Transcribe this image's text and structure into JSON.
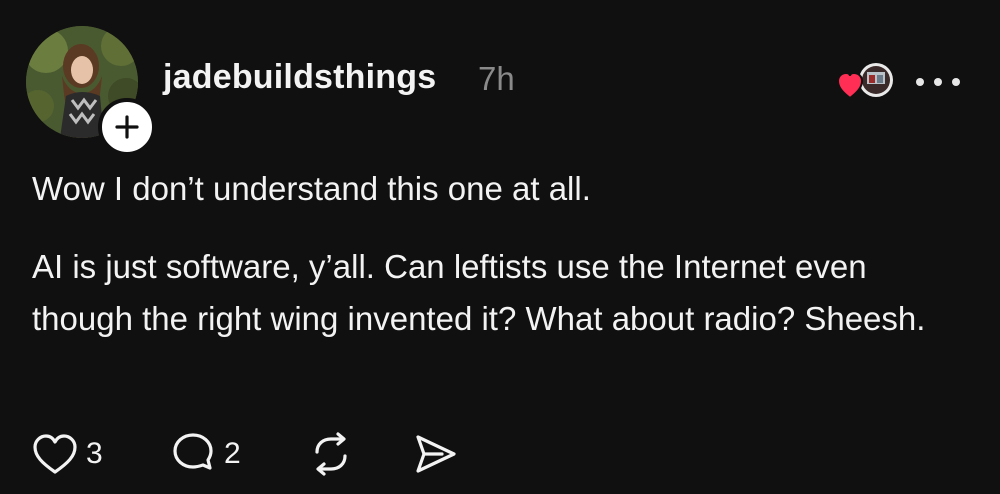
{
  "post": {
    "username": "jadebuildsthings",
    "timestamp": "7h",
    "paragraphs": [
      "Wow I don’t understand this one at all.",
      "AI is just software, y’all. Can leftists use the Internet even though the right wing invented it? What about radio? Sheesh."
    ]
  },
  "actions": {
    "like_count": "3",
    "reply_count": "2"
  },
  "icons": {
    "follow": "plus-icon",
    "liker": "heart-icon",
    "more": "more-horizontal-icon",
    "like": "heart-outline-icon",
    "reply": "chat-bubble-icon",
    "repost": "repost-icon",
    "share": "send-icon"
  },
  "colors": {
    "background": "#101010",
    "text": "#f3f3f3",
    "muted": "#8a8a8a",
    "heart": "#ff2e54"
  }
}
